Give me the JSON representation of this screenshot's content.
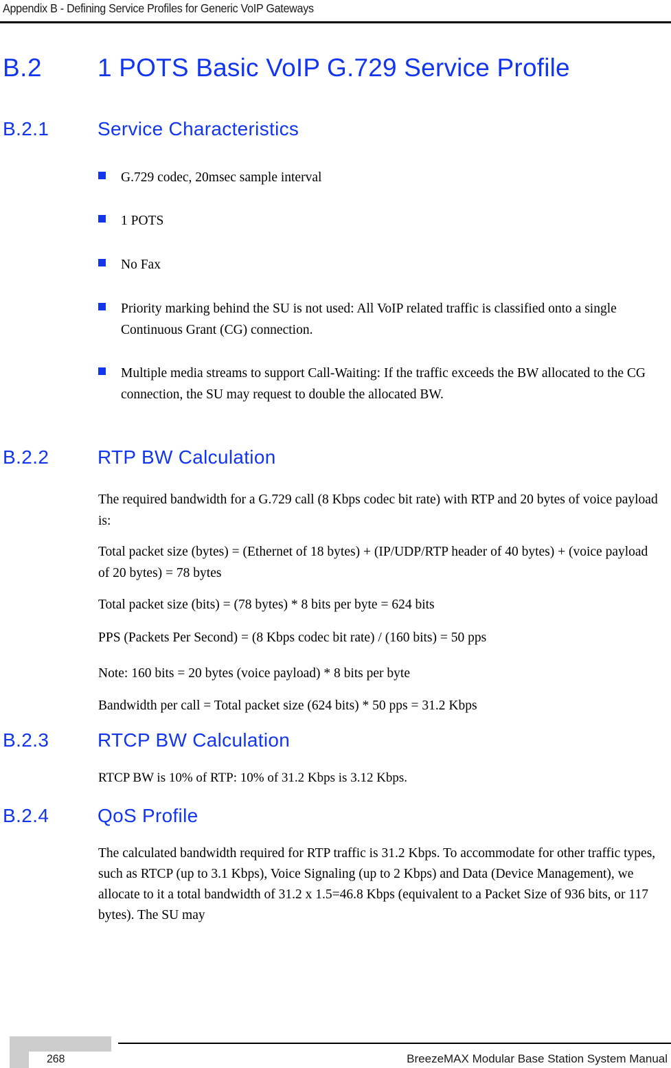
{
  "header": {
    "running_title": "Appendix B - Defining Service Profiles for Generic VoIP Gateways"
  },
  "section": {
    "number": "B.2",
    "title": "1 POTS Basic VoIP G.729 Service Profile"
  },
  "subsections": [
    {
      "number": "B.2.1",
      "title": "Service Characteristics",
      "bullets": [
        "G.729 codec, 20msec sample interval",
        "1 POTS",
        "No Fax",
        "Priority marking behind the SU is not used: All VoIP related traffic is classified onto a single Continuous Grant (CG) connection.",
        "Multiple media streams to support Call-Waiting: If the traffic exceeds the BW allocated to the CG connection, the SU may request to double the allocated BW."
      ]
    },
    {
      "number": "B.2.2",
      "title": "RTP BW Calculation",
      "paragraphs": [
        "The required bandwidth for a G.729 call (8 Kbps codec bit rate) with RTP and 20 bytes of voice payload is:",
        "Total packet size (bytes) = (Ethernet of 18 bytes) + (IP/UDP/RTP header of 40 bytes) + (voice payload of 20 bytes) = 78 bytes",
        "Total packet size (bits) = (78 bytes) * 8 bits per byte = 624 bits",
        "PPS (Packets Per Second) = (8 Kbps codec bit rate) / (160 bits) = 50 pps",
        "Note: 160 bits = 20 bytes (voice payload) * 8 bits per byte",
        "Bandwidth per call = Total packet size (624 bits) * 50 pps = 31.2 Kbps"
      ]
    },
    {
      "number": "B.2.3",
      "title": "RTCP BW Calculation",
      "paragraphs": [
        "RTCP BW is 10% of RTP: 10% of 31.2 Kbps is 3.12 Kbps."
      ]
    },
    {
      "number": "B.2.4",
      "title": "QoS Profile",
      "paragraphs": [
        "The calculated bandwidth required for RTP traffic is 31.2 Kbps. To accommodate for other traffic types, such as RTCP (up to 3.1 Kbps), Voice Signaling (up to 2 Kbps) and Data (Device Management), we allocate to it a total bandwidth of 31.2 x 1.5=46.8 Kbps (equivalent to a Packet Size of 936 bits, or 117 bytes). The SU may"
      ]
    }
  ],
  "footer": {
    "page_number": "268",
    "manual_title": "BreezeMAX Modular Base Station System Manual"
  },
  "colors": {
    "heading_blue": "#1236ee",
    "bullet_blue": "#1236ee",
    "footer_block_gray": "#cccccc",
    "rule_black": "#000000"
  }
}
